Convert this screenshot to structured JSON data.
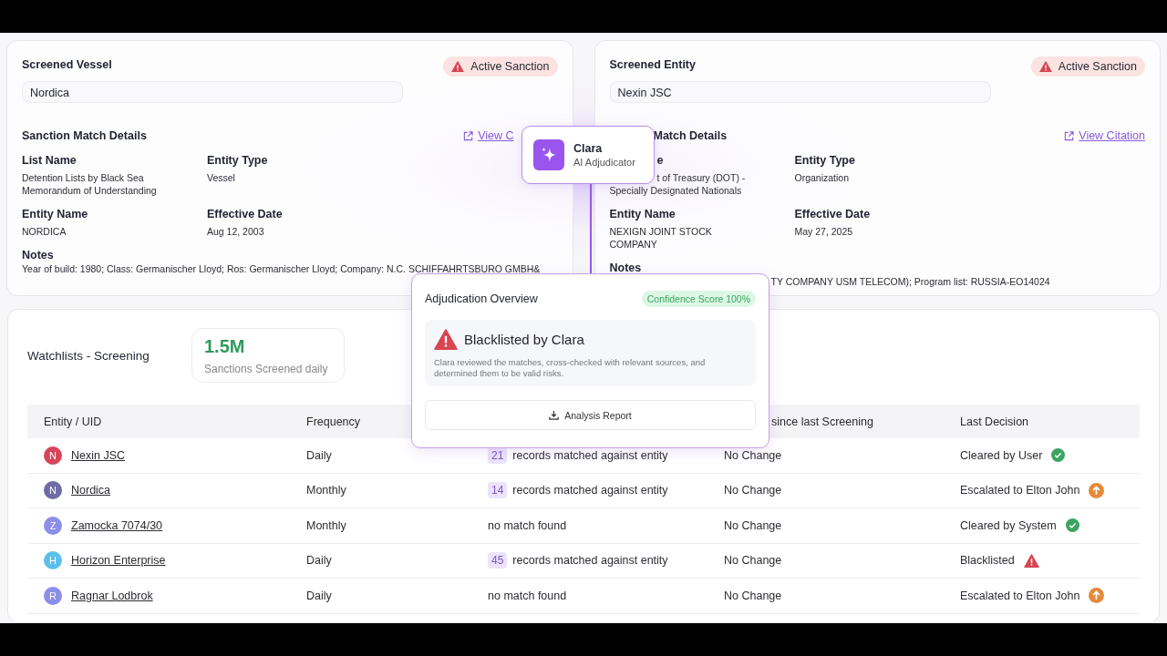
{
  "cards": [
    {
      "title": "Screened Vessel",
      "status": "Active Sanction",
      "field_value": "Nordica",
      "section_title": "Sanction Match Details",
      "link": "View C",
      "details": [
        {
          "label": "List Name",
          "lines": [
            "Detention Lists by Black Sea",
            "Memorandum of Understanding"
          ]
        },
        {
          "label": "Entity Type",
          "lines": [
            "Vessel"
          ]
        },
        {
          "label": "Entity Name",
          "lines": [
            "NORDICA"
          ]
        },
        {
          "label": "Effective Date",
          "lines": [
            "Aug 12, 2003"
          ]
        }
      ],
      "notes_label": "Notes",
      "notes": "Year of build: 1980; Class: Germanischer Lloyd; Ros: Germanischer Lloyd; Company: N.C. SCHIFFAHRTSBURO GMBH&"
    },
    {
      "title": "Screened Entity",
      "status": "Active Sanction",
      "field_value": "Nexin JSC",
      "section_title": "Match Details",
      "link": "View Citation",
      "details": [
        {
          "label": "e",
          "lines": [
            "t of Treasury (DOT) -",
            "Specially Designated Nationals"
          ]
        },
        {
          "label": "Entity Type",
          "lines": [
            "Organization"
          ]
        },
        {
          "label": "Entity Name",
          "lines": [
            "NEXIGN JOINT STOCK",
            "COMPANY"
          ]
        },
        {
          "label": "Effective Date",
          "lines": [
            "May 27, 2025"
          ]
        }
      ],
      "notes_label": "Notes",
      "notes": "TY COMPANY USM TELECOM); Program list: RUSSIA-EO14024"
    }
  ],
  "assistant": {
    "name": "Clara",
    "role": "AI Adjudicator"
  },
  "adjudication": {
    "title": "Adjudication Overview",
    "badge": "Confidence Score 100%",
    "verdict": "Blacklisted by Clara",
    "description": "Clara reviewed the matches, cross-checked with relevant sources, and determined them to be valid risks.",
    "button": "Analysis Report"
  },
  "watchlist": {
    "title": "Watchlists - Screening",
    "stat_value": "1.5M",
    "stat_label": "Sanctions Screened daily",
    "columns": [
      "Entity / UID",
      "Frequency",
      "since last Screening",
      "Last Decision"
    ],
    "rows": [
      {
        "initial": "N",
        "color": "#d6455a",
        "name": "Nexin JSC",
        "frequency": "Daily",
        "matches": {
          "kind": "count",
          "count": "21",
          "text": "records matched against entity"
        },
        "change": "No Change",
        "decision": {
          "kind": "check",
          "text": "Cleared by User"
        }
      },
      {
        "initial": "N",
        "color": "#6d6ca6",
        "name": "Nordica",
        "frequency": "Monthly",
        "matches": {
          "kind": "count",
          "count": "14",
          "text": "records matched against entity"
        },
        "change": "No Change",
        "decision": {
          "kind": "escalate",
          "text": "Escalated to Elton John"
        }
      },
      {
        "initial": "Z",
        "color": "#8b8fe9",
        "name": "Zamocka 7074/30",
        "frequency": "Monthly",
        "matches": {
          "kind": "none",
          "text": "no match found"
        },
        "change": "No Change",
        "decision": {
          "kind": "check",
          "text": "Cleared by System"
        }
      },
      {
        "initial": "H",
        "color": "#5cc1ea",
        "name": "Horizon Enterprise",
        "frequency": "Daily",
        "matches": {
          "kind": "count",
          "count": "45",
          "text": "records matched against entity"
        },
        "change": "No Change",
        "decision": {
          "kind": "warning",
          "text": "Blacklisted"
        }
      },
      {
        "initial": "R",
        "color": "#8a8ee8",
        "name": "Ragnar Lodbrok",
        "frequency": "Daily",
        "matches": {
          "kind": "none",
          "text": "no match found"
        },
        "change": "No Change",
        "decision": {
          "kind": "escalate",
          "text": "Escalated to Elton John"
        }
      }
    ]
  }
}
